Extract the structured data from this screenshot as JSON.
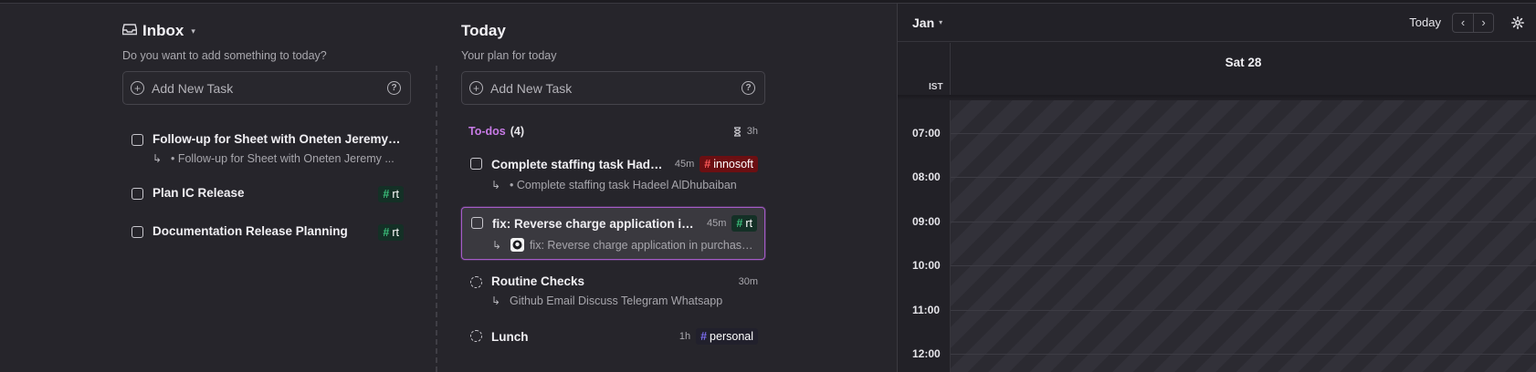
{
  "inbox": {
    "title": "Inbox",
    "subtitle": "Do you want to add something to today?",
    "add_task": "Add New Task",
    "tasks": [
      {
        "title": "Follow-up for Sheet with Oneten Jeremy F...",
        "sub": "• Follow-up for Sheet with Oneten Jeremy ..."
      },
      {
        "title": "Plan IC Release",
        "tag": "rt"
      },
      {
        "title": "Documentation Release Planning",
        "tag": "rt"
      }
    ]
  },
  "today": {
    "title": "Today",
    "subtitle": "Your plan for today",
    "add_task": "Add New Task",
    "section": {
      "name": "To-dos",
      "count": "(4)",
      "duration": "3h"
    },
    "tasks": [
      {
        "title": "Complete staffing task Hadee...",
        "duration": "45m",
        "tag": "innosoft",
        "sub": "• Complete staffing task Hadeel AlDhubaiban"
      },
      {
        "title": "fix: Reverse charge application in p...",
        "duration": "45m",
        "tag": "rt",
        "sub": "fix: Reverse charge application in purchase..."
      },
      {
        "title": "Routine Checks",
        "duration": "30m",
        "sub": "Github Email Discuss Telegram Whatsapp"
      },
      {
        "title": "Lunch",
        "duration": "1h",
        "tag": "personal"
      }
    ]
  },
  "calendar": {
    "month": "Jan",
    "today_button": "Today",
    "day": "Sat 28",
    "timezone": "IST",
    "hours": [
      "07:00",
      "08:00",
      "09:00",
      "10:00",
      "11:00",
      "12:00"
    ]
  },
  "colors": {
    "background": "#26252b",
    "accent_purple": "#c87be6",
    "tag_rt": "#143026",
    "tag_innosoft": "#6b0f12"
  }
}
